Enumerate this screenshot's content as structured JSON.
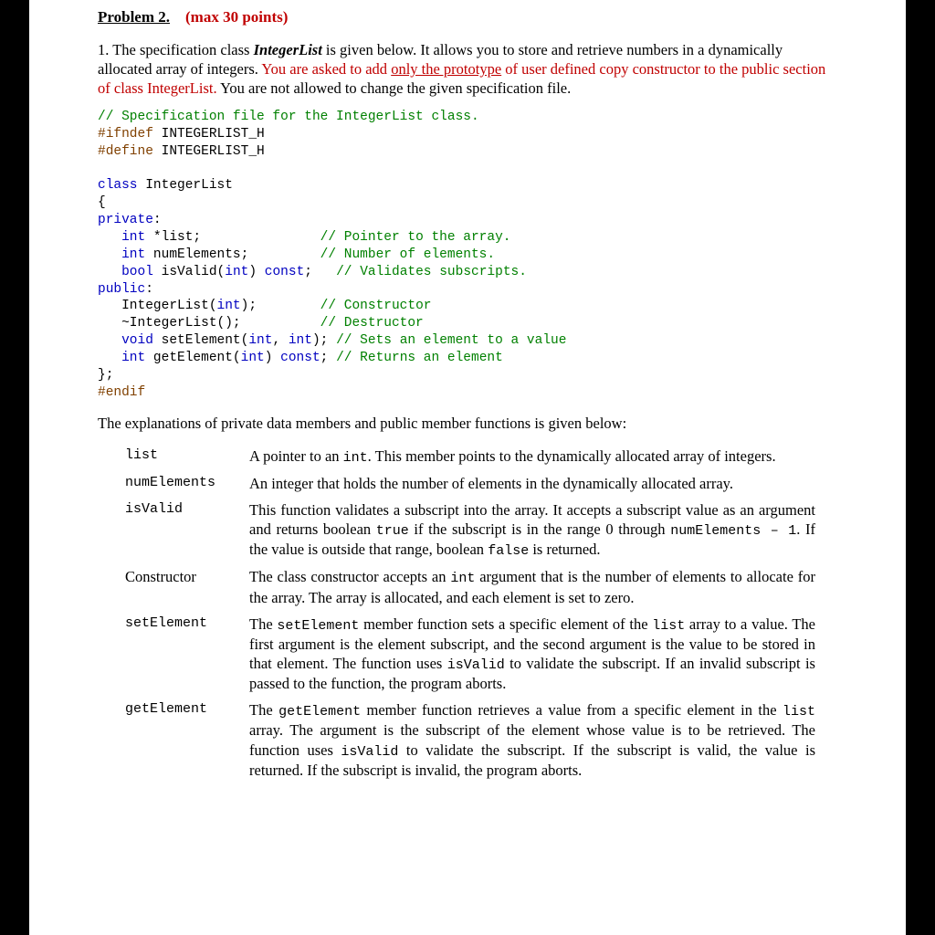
{
  "header": {
    "problem": "Problem 2.",
    "points": "(max 30 points)"
  },
  "intro": {
    "num": "1.",
    "t1": "The specification class ",
    "className": "IntegerList",
    "t2": " is given below. It allows you to store and retrieve numbers in a dynamically allocated array of integers. ",
    "red1": "You are asked to add ",
    "redU": "only the prototype",
    "red2": " of user defined copy constructor to the public section of class IntegerList.",
    "t3": " You are not allowed to change the given specification file."
  },
  "code": {
    "l1c": "// Specification file for the IntegerList class.",
    "l2a": "#ifndef",
    "l2b": " INTEGERLIST_H",
    "l3a": "#define",
    "l3b": " INTEGERLIST_H",
    "l5a": "class",
    "l5b": " IntegerList",
    "l6": "{",
    "l7a": "private",
    "l7b": ":",
    "l8a": "   ",
    "l8b": "int",
    "l8c": " *list;               ",
    "l8d": "// Pointer to the array.",
    "l9a": "   ",
    "l9b": "int",
    "l9c": " numElements;         ",
    "l9d": "// Number of elements.",
    "l10a": "   ",
    "l10b": "bool",
    "l10c": " isValid(",
    "l10d": "int",
    "l10e": ") ",
    "l10f": "const",
    "l10g": ";   ",
    "l10h": "// Validates subscripts.",
    "l11a": "public",
    "l11b": ":",
    "l12a": "   IntegerList(",
    "l12b": "int",
    "l12c": ");        ",
    "l12d": "// Constructor",
    "l13a": "   ~IntegerList();          ",
    "l13b": "// Destructor",
    "l14a": "   ",
    "l14b": "void",
    "l14c": " setElement(",
    "l14d": "int",
    "l14e": ", ",
    "l14f": "int",
    "l14g": "); ",
    "l14h": "// Sets an element to a value",
    "l15a": "   ",
    "l15b": "int",
    "l15c": " getElement(",
    "l15d": "int",
    "l15e": ") ",
    "l15f": "const",
    "l15g": "; ",
    "l15h": "// Returns an element",
    "l16": "};",
    "l17": "#endif"
  },
  "explainIntro": "The explanations of private data members and public member functions is given below:",
  "defs": {
    "list": {
      "term": "list",
      "d1": "A pointer to an ",
      "c1": "int",
      "d2": ". This member points to the dynamically allocated array of integers."
    },
    "numElements": {
      "term": "numElements",
      "d1": "An integer that holds the number of elements in the dynamically allocated array."
    },
    "isValid": {
      "term": "isValid",
      "d1": "This function validates a subscript into the array. It accepts a subscript value as an argument and returns boolean ",
      "c1": "true",
      "d2": " if the subscript is in the range 0 through ",
      "c2": "numElements – 1",
      "d3": ". If the value is outside that range, boolean ",
      "c3": "false",
      "d4": " is returned."
    },
    "constructor": {
      "term": "Constructor",
      "d1": "The class constructor accepts an ",
      "c1": "int",
      "d2": " argument that is the number of elements to allocate for the array. The array is allocated, and each element is set to zero."
    },
    "setElement": {
      "term": "setElement",
      "d1": "The ",
      "c1": "setElement",
      "d2": " member function sets a specific element of the ",
      "c2": "list",
      "d3": " array to a value. The first argument is the element subscript, and the second argument is the value to be stored in that element. The function uses ",
      "c3": "isValid",
      "d4": " to validate the subscript. If an invalid subscript is passed to the function, the program aborts."
    },
    "getElement": {
      "term": "getElement",
      "d1": "The ",
      "c1": "getElement",
      "d2": " member function retrieves a value from a specific element in the ",
      "c2": "list",
      "d3": " array. The argument is the subscript of the element whose value is to be retrieved. The function uses ",
      "c3": "isValid",
      "d4": " to validate the subscript. If the subscript is valid, the value is returned. If the subscript is invalid, the program aborts."
    }
  }
}
